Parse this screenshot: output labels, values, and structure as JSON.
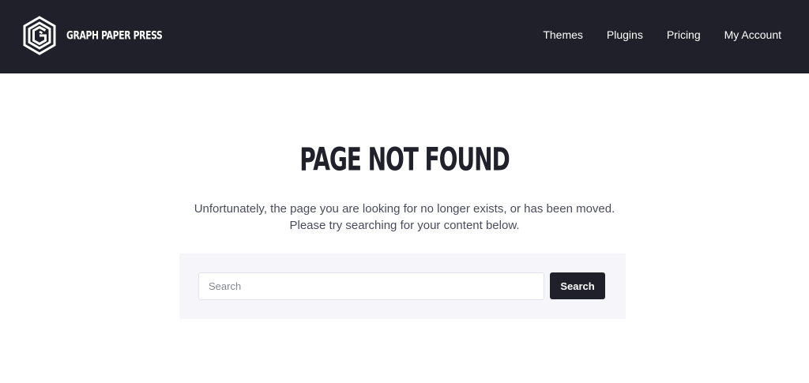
{
  "header": {
    "brand_text": "GRAPH PAPER PRESS",
    "logo_icon": "hexagon-g-logo-icon",
    "background_color": "#1f2029",
    "nav": [
      {
        "label": "Themes"
      },
      {
        "label": "Plugins"
      },
      {
        "label": "Pricing"
      },
      {
        "label": "My Account"
      }
    ]
  },
  "main": {
    "title": "PAGE NOT FOUND",
    "message": "Unfortunately, the page you are looking for no longer exists, or has been moved. Please try searching for your content below.",
    "search": {
      "placeholder": "Search",
      "value": "",
      "button_label": "Search"
    },
    "colors": {
      "text": "#1f2027",
      "muted_text": "#4a4c5c",
      "panel_background": "#f6f6fa"
    }
  }
}
